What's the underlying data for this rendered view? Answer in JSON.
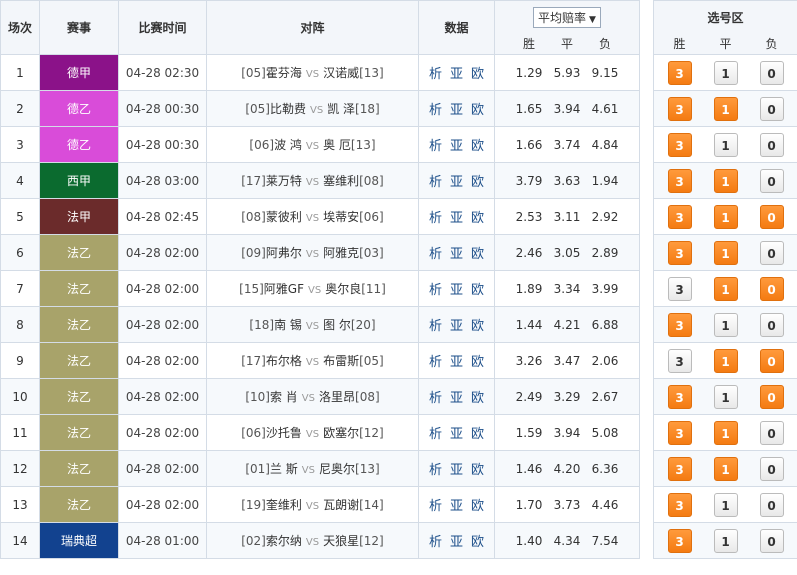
{
  "header": {
    "col_idx": "场次",
    "col_league": "赛事",
    "col_time": "比赛时间",
    "col_match": "对阵",
    "col_data": "数据",
    "avg_odds_select": "平均赔率",
    "odds_sub": [
      "胜",
      "平",
      "负"
    ],
    "pick_title": "选号区",
    "pick_sub": [
      "胜",
      "平",
      "负"
    ]
  },
  "vs_label": "VS",
  "data_links": [
    "析",
    "亚",
    "欧"
  ],
  "colors": {
    "德甲": "#8b1289",
    "德乙": "#d94cd9",
    "西甲": "#0b6b2f",
    "法甲": "#6b2b2b",
    "法乙": "#a8a36a",
    "瑞典超": "#12428f",
    "pick_on": "#f47b12"
  },
  "rows": [
    {
      "idx": "1",
      "league": "德甲",
      "time": "04-28 02:30",
      "home_rank": "[05]",
      "home": "霍芬海",
      "away": "汉诺威",
      "away_rank": "[13]",
      "o": [
        "1.29",
        "5.93",
        "9.15"
      ],
      "p": [
        "3",
        "1",
        "0"
      ],
      "on": [
        true,
        false,
        false
      ]
    },
    {
      "idx": "2",
      "league": "德乙",
      "time": "04-28 00:30",
      "home_rank": "[05]",
      "home": "比勒费",
      "away": "凯 泽",
      "away_rank": "[18]",
      "o": [
        "1.65",
        "3.94",
        "4.61"
      ],
      "p": [
        "3",
        "1",
        "0"
      ],
      "on": [
        true,
        true,
        false
      ]
    },
    {
      "idx": "3",
      "league": "德乙",
      "time": "04-28 00:30",
      "home_rank": "[06]",
      "home": "波 鸿",
      "away": "奥 厄",
      "away_rank": "[13]",
      "o": [
        "1.66",
        "3.74",
        "4.84"
      ],
      "p": [
        "3",
        "1",
        "0"
      ],
      "on": [
        true,
        false,
        false
      ]
    },
    {
      "idx": "4",
      "league": "西甲",
      "time": "04-28 03:00",
      "home_rank": "[17]",
      "home": "莱万特",
      "away": "塞维利",
      "away_rank": "[08]",
      "o": [
        "3.79",
        "3.63",
        "1.94"
      ],
      "p": [
        "3",
        "1",
        "0"
      ],
      "on": [
        true,
        true,
        false
      ]
    },
    {
      "idx": "5",
      "league": "法甲",
      "time": "04-28 02:45",
      "home_rank": "[08]",
      "home": "蒙彼利",
      "away": "埃蒂安",
      "away_rank": "[06]",
      "o": [
        "2.53",
        "3.11",
        "2.92"
      ],
      "p": [
        "3",
        "1",
        "0"
      ],
      "on": [
        true,
        true,
        true
      ]
    },
    {
      "idx": "6",
      "league": "法乙",
      "time": "04-28 02:00",
      "home_rank": "[09]",
      "home": "阿弗尔",
      "away": "阿雅克",
      "away_rank": "[03]",
      "o": [
        "2.46",
        "3.05",
        "2.89"
      ],
      "p": [
        "3",
        "1",
        "0"
      ],
      "on": [
        true,
        true,
        false
      ]
    },
    {
      "idx": "7",
      "league": "法乙",
      "time": "04-28 02:00",
      "home_rank": "[15]",
      "home": "阿雅GF",
      "away": "奥尔良",
      "away_rank": "[11]",
      "o": [
        "1.89",
        "3.34",
        "3.99"
      ],
      "p": [
        "3",
        "1",
        "0"
      ],
      "on": [
        false,
        true,
        true
      ]
    },
    {
      "idx": "8",
      "league": "法乙",
      "time": "04-28 02:00",
      "home_rank": "[18]",
      "home": "南 锡",
      "away": "图 尔",
      "away_rank": "[20]",
      "o": [
        "1.44",
        "4.21",
        "6.88"
      ],
      "p": [
        "3",
        "1",
        "0"
      ],
      "on": [
        true,
        false,
        false
      ]
    },
    {
      "idx": "9",
      "league": "法乙",
      "time": "04-28 02:00",
      "home_rank": "[17]",
      "home": "布尔格",
      "away": "布雷斯",
      "away_rank": "[05]",
      "o": [
        "3.26",
        "3.47",
        "2.06"
      ],
      "p": [
        "3",
        "1",
        "0"
      ],
      "on": [
        false,
        true,
        true
      ]
    },
    {
      "idx": "10",
      "league": "法乙",
      "time": "04-28 02:00",
      "home_rank": "[10]",
      "home": "索 肖",
      "away": "洛里昂",
      "away_rank": "[08]",
      "o": [
        "2.49",
        "3.29",
        "2.67"
      ],
      "p": [
        "3",
        "1",
        "0"
      ],
      "on": [
        true,
        false,
        true
      ]
    },
    {
      "idx": "11",
      "league": "法乙",
      "time": "04-28 02:00",
      "home_rank": "[06]",
      "home": "沙托鲁",
      "away": "欧塞尔",
      "away_rank": "[12]",
      "o": [
        "1.59",
        "3.94",
        "5.08"
      ],
      "p": [
        "3",
        "1",
        "0"
      ],
      "on": [
        true,
        true,
        false
      ]
    },
    {
      "idx": "12",
      "league": "法乙",
      "time": "04-28 02:00",
      "home_rank": "[01]",
      "home": "兰 斯",
      "away": "尼奥尔",
      "away_rank": "[13]",
      "o": [
        "1.46",
        "4.20",
        "6.36"
      ],
      "p": [
        "3",
        "1",
        "0"
      ],
      "on": [
        true,
        true,
        false
      ]
    },
    {
      "idx": "13",
      "league": "法乙",
      "time": "04-28 02:00",
      "home_rank": "[19]",
      "home": "奎维利",
      "away": "瓦朗谢",
      "away_rank": "[14]",
      "o": [
        "1.70",
        "3.73",
        "4.46"
      ],
      "p": [
        "3",
        "1",
        "0"
      ],
      "on": [
        true,
        false,
        false
      ]
    },
    {
      "idx": "14",
      "league": "瑞典超",
      "time": "04-28 01:00",
      "home_rank": "[02]",
      "home": "索尔纳",
      "away": "天狼星",
      "away_rank": "[12]",
      "o": [
        "1.40",
        "4.34",
        "7.54"
      ],
      "p": [
        "3",
        "1",
        "0"
      ],
      "on": [
        true,
        false,
        false
      ]
    }
  ]
}
